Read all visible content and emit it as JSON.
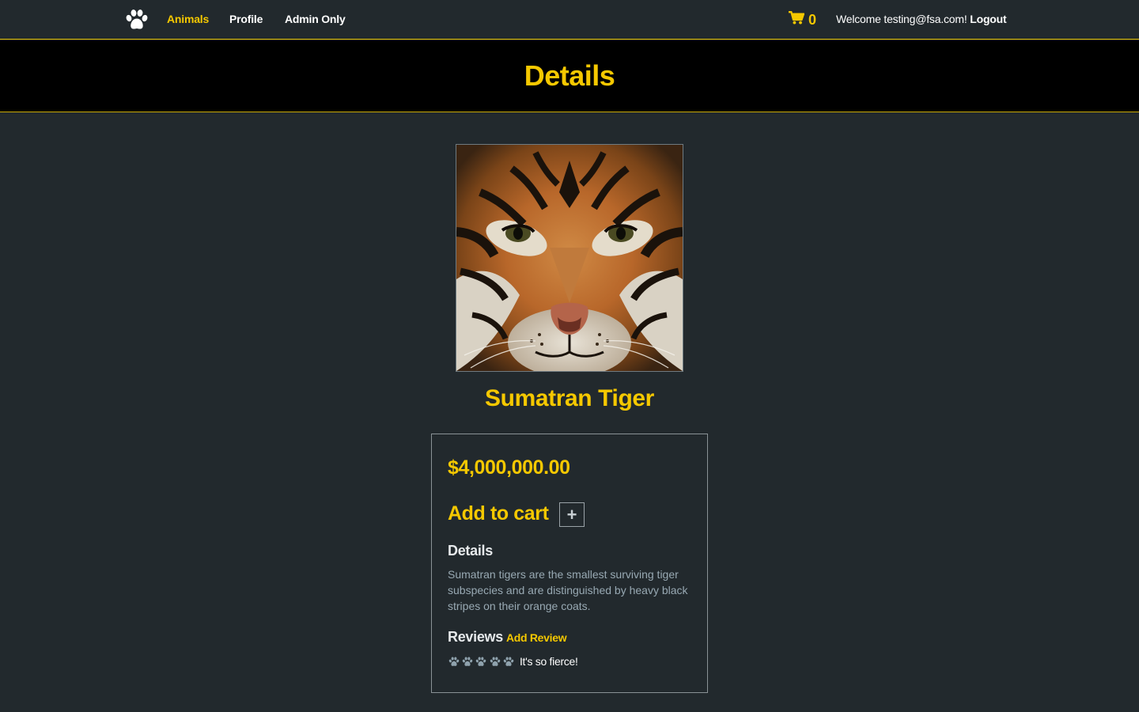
{
  "navbar": {
    "brand_icon": "paw-icon",
    "links": [
      {
        "label": "Animals",
        "active": true
      },
      {
        "label": "Profile",
        "active": false
      },
      {
        "label": "Admin Only",
        "active": false
      }
    ],
    "cart_icon": "shopping-cart-icon",
    "cart_count": "0",
    "welcome_text": "Welcome testing@fsa.com!",
    "logout_label": "Logout"
  },
  "header": {
    "title": "Details"
  },
  "product": {
    "image_alt": "Sumatran Tiger",
    "name": "Sumatran Tiger",
    "price": "$4,000,000.00",
    "add_to_cart_label": "Add to cart",
    "add_button_symbol": "+",
    "details_heading": "Details",
    "description": "Sumatran tigers are the smallest surviving tiger subspecies and are distinguished by heavy black stripes on their orange coats.",
    "reviews_heading": "Reviews",
    "add_review_label": "Add Review",
    "reviews": [
      {
        "rating": 5,
        "rating_icon": "paw-icon",
        "text": "It's so fierce!"
      }
    ]
  },
  "colors": {
    "accent": "#f5c800",
    "background": "#22292d",
    "header_band": "#000000",
    "muted_text": "#98a9b3",
    "rating_paw": "#8fa2ad"
  }
}
